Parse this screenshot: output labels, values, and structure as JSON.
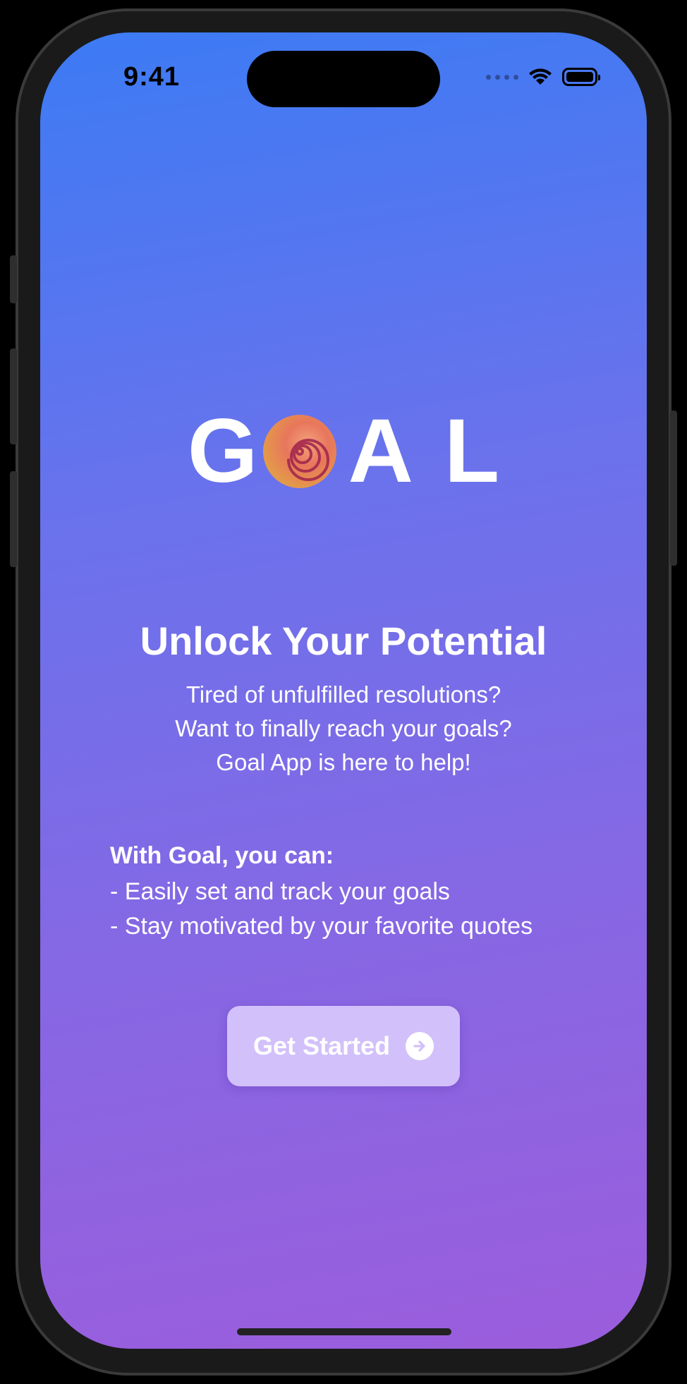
{
  "status_bar": {
    "time": "9:41"
  },
  "logo": {
    "letters": [
      "G",
      "A",
      "L"
    ]
  },
  "hero": {
    "headline": "Unlock Your Potential",
    "lines": [
      "Tired of unfulfilled resolutions?",
      "Want to finally reach your goals?",
      "Goal App is here to help!"
    ]
  },
  "features": {
    "title": "With Goal, you can:",
    "items": [
      "- Easily set and track your goals",
      "- Stay motivated by your favorite quotes"
    ]
  },
  "cta": {
    "label": "Get Started"
  },
  "icons": {
    "status": [
      "signal-icon",
      "wifi-icon",
      "battery-icon"
    ],
    "cta": "arrow-right-circle-icon",
    "logo": "spiral-ball-icon"
  },
  "colors": {
    "gradient_top": "#3c7bf4",
    "gradient_bottom": "#9b5ddc",
    "button_bg": "#d2c0fa",
    "text": "#ffffff"
  }
}
